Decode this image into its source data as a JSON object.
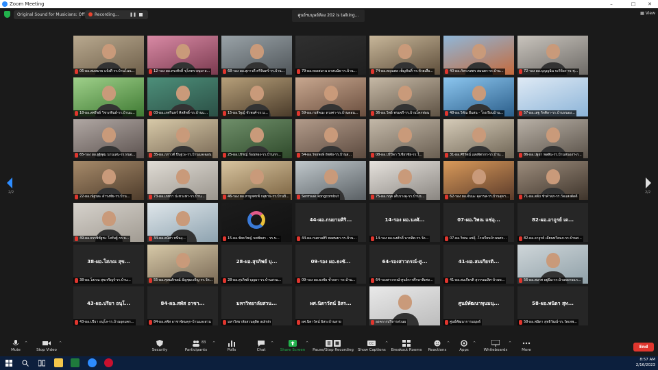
{
  "window": {
    "title": "Zoom Meeting"
  },
  "topbar": {
    "sound_pill": "Original Sound for Musicians: Off",
    "recording_pill": "Recording...",
    "talking": "ศูนย์ฯมนุษย์ห้อง 202 is talking...",
    "view_label": "View"
  },
  "pager": {
    "left": "2/2",
    "right": "2/2"
  },
  "tiles": [
    {
      "name": "06-ผอ.สมหมาย แจ้งดี-รร.บ้านโนน..."
    },
    {
      "name": "12-รอง ผอ.ทรงศักดิ์ ขุโคตร-อนุบาล..."
    },
    {
      "name": "68-รอง ผอ.สุภาวดี ศรีจันทร์-รร.บ้าน..."
    },
    {
      "name": "79-ผอ.ทองสมาน อาสนนัย-รร.บ้าน..."
    },
    {
      "name": "74-ผอ.ตฤณพล เพ็ญทันติ์-รร.ห้วยเสือ..."
    },
    {
      "name": "40-ผอ.ภัทรเรสพร สมนตร-รร.บ้าน..."
    },
    {
      "name": "72-รอง ผอ.บุญญฉัน จะริจ้อร-รร.ชุ..."
    },
    {
      "name": "18-ผอ.สพรีชย์ วิชาภพินธ์-รร.บ้านแ..."
    },
    {
      "name": "03-ผอ.เกศรินทร์ ศิลสิทธิ์-รร.บ้านแ..."
    },
    {
      "name": "15-ผอ.วิฐญ์ ชั่วพงศ์-รร.บ..."
    },
    {
      "name": "59-ผอ.กรลัคนะ ดวงศา-รร.บ้านดอน..."
    },
    {
      "name": "36-ผอ.วิพผ์ พรมจรี-รร.บ้านโคกท่อน"
    },
    {
      "name": "48-ผอ.วิพัณ ผีแสน - โรงเรียนบ้าน..."
    },
    {
      "name": "57-ผอ.เสฐ กิจศิลา-รร.บ้านหนอง..."
    },
    {
      "name": "65-รอง ผอ.ฐฐิพุฒ นานเสน-รร.หนอ..."
    },
    {
      "name": "35-ผอ.ภภาวดี ปิ่นฐวะ-รร.บ้านแลงฉอน"
    },
    {
      "name": "25-ผอ.ปรัชญ์ ก้อนทอง-รร.บ้านกก..."
    },
    {
      "name": "54-ผอ.รัจยพงษ์ อิชจัย-รร.บ้านส..."
    },
    {
      "name": "08-ผอ.ปร์ปีดา วิเชียรชัย-รร.ใ..."
    },
    {
      "name": "31-ผอ.ศิริรัตน์ แสงจิตรกร-รร.บ้าน..."
    },
    {
      "name": "86-ผอ.ปฐยา พลสิน-รร.บ้านหนองฯ-ภ..."
    },
    {
      "name": "22-ผอ.ณัฐรสะ ดำรงชัย-รร.บ้าน..."
    },
    {
      "name": "73-ผอ.เภทรา ปะทวะพา-รร.บ้าน..."
    },
    {
      "name": "46-รอง ผอ.หายูพศรพ์ กสุยาน-รร.บ้านปิ..."
    },
    {
      "name": "Sermsak kongcombut"
    },
    {
      "name": "75-ผอ.กฤต เดีบรางคุ-รร.บ้านร..."
    },
    {
      "name": "62-รอง ผอ.จันนะ คุลารส-รร.บ้านสุดฯ..."
    },
    {
      "name": "71-ผอ.สลับ ชำคำสภ-รร.วัดแสงตัดดี"
    },
    {
      "name": "49-ผอ.ธรรพิชัฐชะ โสรัษฐ์-รร.บ..."
    },
    {
      "name": "34-ผอ.อนัสา หนีนงุ..."
    },
    {
      "name": "15-ผอ.ชัยธวัชญ์ นพชัยสร - รร.บ..."
    },
    {
      "name": "44-ผอ.กนยามศิริ พลศษยา-รร.บ้าน..."
    },
    {
      "name": "14-รอง ผอ.นงศักดิ์ นวกสิต-รร.วัด..."
    },
    {
      "name": "07-ผอ.วิพณ แซ่อุ้ -โรงเรียนบ้านนศร..."
    },
    {
      "name": "82-ผอ.อาจูรย์ เดียนพวีสมภ-รร.บ้านศ..."
    },
    {
      "name": "38-ผอ.โสภณ สุขเจริญจ์-รร.บ้าน..."
    },
    {
      "name": "55-ผอ.คุหมลักษณ์ อัญชุมเจริญ-รร.วัด..."
    },
    {
      "name": "28-ผอ.สุรภิพย์ บุญมา-รร.บ้านสวน..."
    },
    {
      "name": "09-รอง ผอ.ธงชัย ช้ำลลา -รร.บ้าน..."
    },
    {
      "name": "64-รองสาวกรณ์-ศูนย์การศึกษาพิเศษ..."
    },
    {
      "name": "41-ผอ.สมเกียรติ สุวรรณเลิศ-บ้านข..."
    },
    {
      "name": "56-ผอ.สมาศ อยู่นิ่ม-รร.บ้านขยายแก..."
    },
    {
      "name": "43-ผอ.ปรียา อนุโล-รร.บ้านอุดมคร..."
    },
    {
      "name": "84-ผอ.สพัส อาชาจัดมคุก-บ้านแลงสวน"
    },
    {
      "name": "มหาวิทยาลัยสวนดุสิต admin"
    },
    {
      "name": "ผศ.นิตาวัตน์ อิสระบ้านสาย"
    },
    {
      "name": "องคการบริหารส่วนผ"
    },
    {
      "name": "ศูนย์พัฒนาการมนุษย์"
    },
    {
      "name": "58-ผอ.พนิดา สุทธิวัฒน์-รร.วัดเทพ..."
    }
  ],
  "tile_big_names": {
    "31": "44-ผอ.กนยามศิริ...",
    "32": "14-รอง ผอ.นงศั...",
    "33": "07-ผอ.วิพณ แซ่อุ...",
    "34": "82-ผอ.อาจูรย์ เด...",
    "35": "38-ผอ.โสภณ สุข...",
    "37": "28-ผอ.สุรภิพย์ บุ...",
    "38": "09-รอง ผอ.ธงชั...",
    "39": "64-รองสาวกรณ์-ศู...",
    "40": "41-ผอ.สมเกียรติ...",
    "42": "43-ผอ.ปรียา อนุโ...",
    "43": "84-ผอ.สพัส อาชา...",
    "44": "มหาวิทยาลัยสวน...",
    "45": "ผศ.นิตาวัตน์ อิสร...",
    "47": "ศูนย์พัฒนาหุนมนุ...",
    "48": "58-ผอ.พนิดา สุท..."
  },
  "toolbar": {
    "mute": "Mute",
    "stop_video": "Stop Video",
    "security": "Security",
    "participants": "Participants",
    "participant_count": "83",
    "polls": "Polls",
    "chat": "Chat",
    "share_screen": "Share Screen",
    "pause_recording": "Pause/Stop Recording",
    "show_captions": "Show Captions",
    "breakout_rooms": "Breakout Rooms",
    "reactions": "Reactions",
    "apps": "Apps",
    "whiteboards": "Whiteboards",
    "more": "More",
    "end": "End"
  },
  "taskbar": {
    "time": "8:57 AM",
    "date": "2/16/2023"
  },
  "colors": {
    "share_green": "#22b24c",
    "end_red": "#e0362e",
    "zoom_blue": "#2d8cff"
  }
}
